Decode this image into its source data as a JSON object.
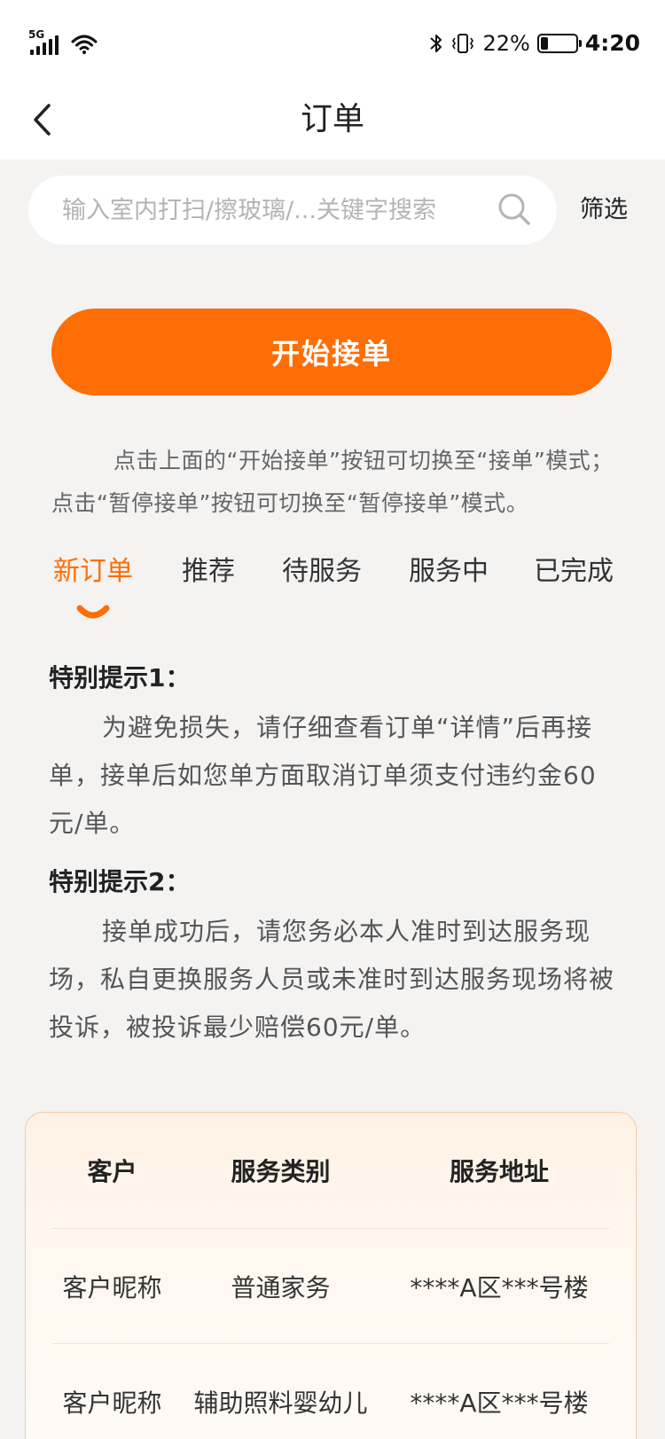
{
  "status_bar": {
    "network": "5G",
    "battery_percent": "22%",
    "battery_level": 0.22,
    "time": "4:20"
  },
  "nav": {
    "title": "订单"
  },
  "search": {
    "placeholder": "输入室内打扫/擦玻璃/...关键字搜索",
    "value": ""
  },
  "filter_label": "筛选",
  "start_button_label": "开始接单",
  "mode_hint": "点击上面的“开始接单”按钮可切换至“接单”模式；点击“暂停接单”按钮可切换至“暂停接单”模式。",
  "tabs": [
    {
      "label": "新订单",
      "active": true
    },
    {
      "label": "推荐",
      "active": false
    },
    {
      "label": "待服务",
      "active": false
    },
    {
      "label": "服务中",
      "active": false
    },
    {
      "label": "已完成",
      "active": false
    }
  ],
  "notices": [
    {
      "title": "特别提示1：",
      "body": "为避免损失，请仔细查看订单“详情”后再接单，接单后如您单方面取消订单须支付违约金60元/单。"
    },
    {
      "title": "特别提示2：",
      "body": "接单成功后，请您务必本人准时到达服务现场，私自更换服务人员或未准时到达服务现场将被投诉，被投诉最少赔偿60元/单。"
    }
  ],
  "order_table": {
    "headers": [
      "客户",
      "服务类别",
      "服务地址"
    ],
    "rows": [
      [
        "客户昵称",
        "普通家务",
        "****A区***号楼"
      ],
      [
        "客户昵称",
        "辅助照料婴幼儿",
        "****A区***号楼"
      ]
    ]
  },
  "colors": {
    "accent": "#ff6d05",
    "background": "#f4f3f2",
    "card_border": "#f8c9a3"
  }
}
